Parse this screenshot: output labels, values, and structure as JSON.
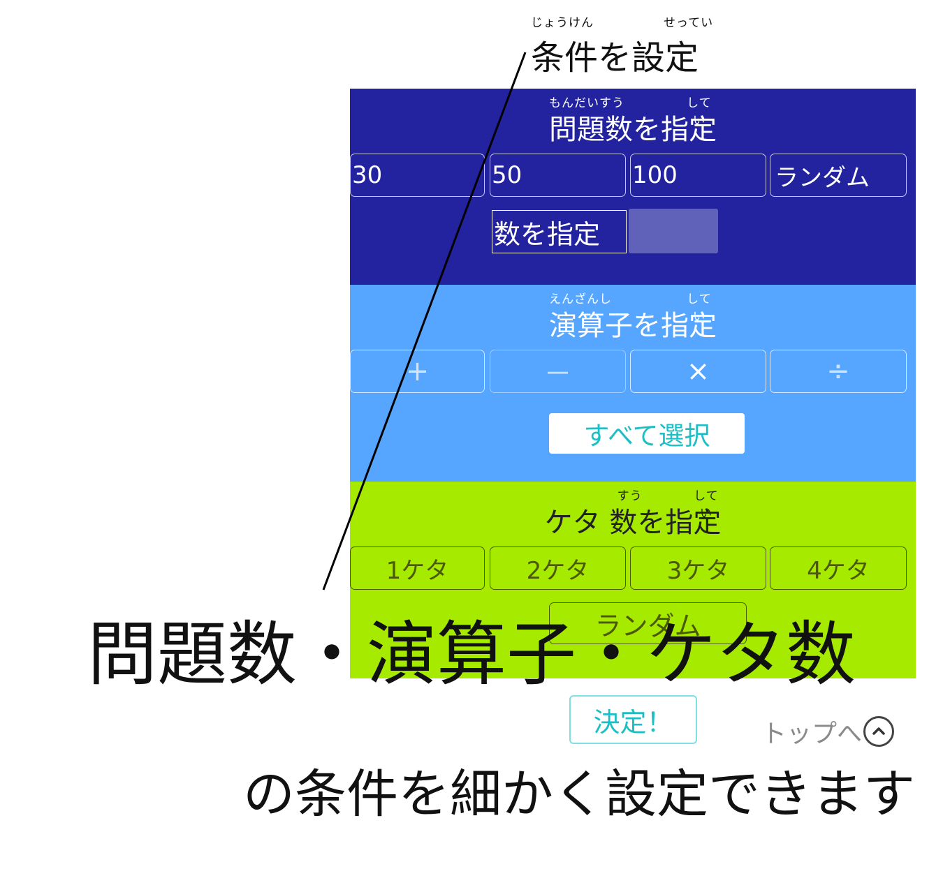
{
  "header": {
    "title": "条件を設定",
    "ruby_left": "じょうけん",
    "ruby_right": "せってい"
  },
  "count_section": {
    "title": "問題数を指定",
    "ruby_left": "もんだいすう",
    "ruby_right": "してい",
    "options": [
      "30",
      "50",
      "100",
      "ランダム"
    ],
    "custom_label": "数を指定",
    "custom_value": "",
    "color": "#2323a0"
  },
  "operator_section": {
    "title": "演算子を指定",
    "ruby_left": "えんざんし",
    "ruby_right": "してい",
    "options": [
      "+",
      "－",
      "×",
      "÷"
    ],
    "select_all": "すべて選択",
    "color": "#56a5fe"
  },
  "digit_section": {
    "title_prefix": "ケタ",
    "title": "数を指定",
    "ruby_left": "すう",
    "ruby_right": "してい",
    "options": [
      "1ケタ",
      "2ケタ",
      "3ケタ",
      "4ケタ"
    ],
    "random": "ランダム",
    "color": "#a6ea00"
  },
  "decide_button": "決定！",
  "to_top": "トップへ",
  "overlay": {
    "line1": "問題数・演算子・ケタ数",
    "line2": "の条件を細かく設定できます"
  },
  "icons": [
    "chevron-up-icon"
  ]
}
